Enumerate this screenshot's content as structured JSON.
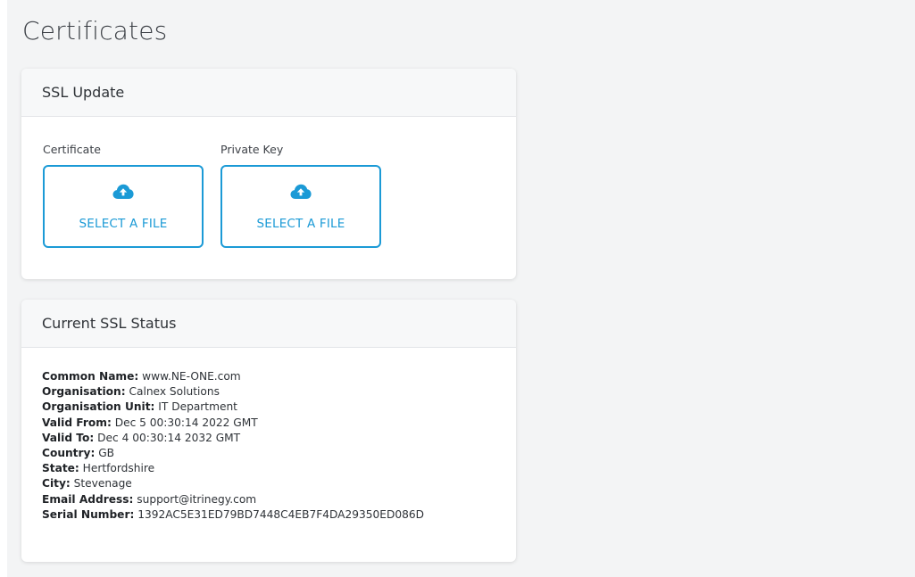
{
  "page": {
    "title": "Certificates"
  },
  "ssl_update": {
    "header": "SSL Update",
    "certificate": {
      "label": "Certificate",
      "button_text": "SELECT A FILE",
      "icon": "cloud-upload-icon"
    },
    "private_key": {
      "label": "Private Key",
      "button_text": "SELECT A FILE",
      "icon": "cloud-upload-icon"
    }
  },
  "ssl_status": {
    "header": "Current SSL Status",
    "fields": [
      {
        "label": "Common Name:",
        "value": "www.NE-ONE.com"
      },
      {
        "label": "Organisation:",
        "value": "Calnex Solutions"
      },
      {
        "label": "Organisation Unit:",
        "value": "IT Department"
      },
      {
        "label": "Valid From:",
        "value": "Dec 5 00:30:14 2022 GMT"
      },
      {
        "label": "Valid To:",
        "value": "Dec 4 00:30:14 2032 GMT"
      },
      {
        "label": "Country:",
        "value": "GB"
      },
      {
        "label": "State:",
        "value": "Hertfordshire"
      },
      {
        "label": "City:",
        "value": "Stevenage"
      },
      {
        "label": "Email Address:",
        "value": "support@itrinegy.com"
      },
      {
        "label": "Serial Number:",
        "value": "1392AC5E31ED79BD7448C4EB7F4DA29350ED086D"
      }
    ]
  },
  "colors": {
    "accent": "#1b9ad6",
    "background": "#f3f4f5",
    "card": "#ffffff",
    "card_header": "#f7f8f9"
  }
}
